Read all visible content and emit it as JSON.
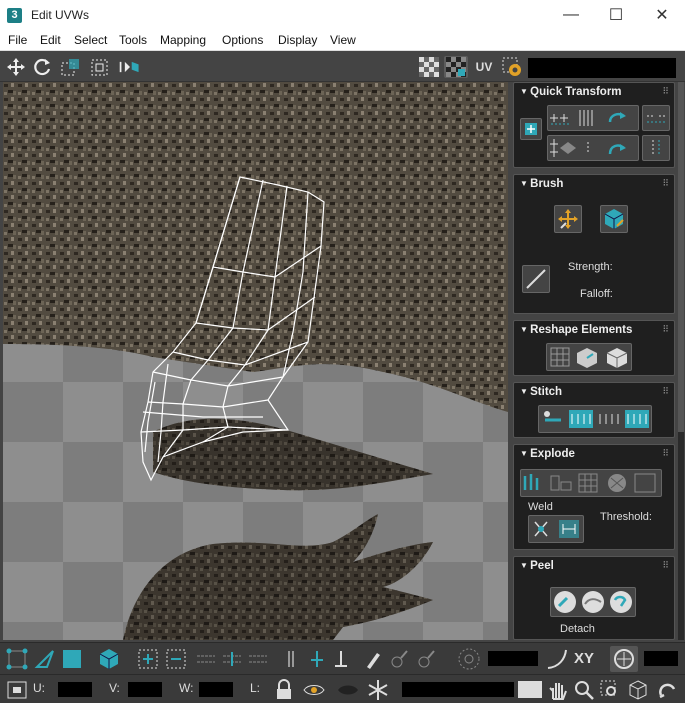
{
  "window": {
    "title": "Edit UVWs",
    "app_icon": "3",
    "minimize": "—",
    "maximize": "☐",
    "close": "✕"
  },
  "menu": [
    "File",
    "Edit",
    "Select",
    "Tools",
    "Mapping",
    "Options",
    "Display",
    "View"
  ],
  "toolbar": {
    "uv_label": "UV"
  },
  "panels": {
    "quick_transform": {
      "title": "Quick Transform"
    },
    "brush": {
      "title": "Brush",
      "strength_label": "Strength:",
      "falloff_label": "Falloff:"
    },
    "reshape": {
      "title": "Reshape Elements"
    },
    "stitch": {
      "title": "Stitch"
    },
    "explode": {
      "title": "Explode",
      "weld_label": "Weld",
      "threshold_label": "Threshold:"
    },
    "peel": {
      "title": "Peel",
      "detach_label": "Detach"
    }
  },
  "bottom": {
    "xy_label": "XY",
    "u_label": "U:",
    "v_label": "V:",
    "w_label": "W:",
    "l_label": "L:"
  },
  "colors": {
    "accent": "#2fa8b8",
    "panel_bg": "#1f1f1f",
    "toolbar_bg": "#444444",
    "mesh": "#ffffff"
  }
}
